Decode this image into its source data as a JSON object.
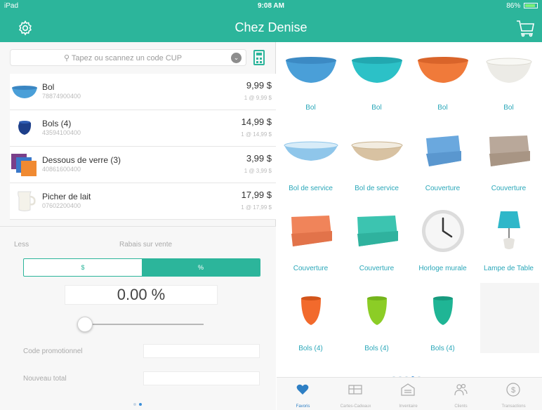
{
  "status": {
    "device": "iPad",
    "time": "9:08 AM",
    "battery": "86%",
    "battery_level": 0.86
  },
  "header": {
    "title": "Chez Denise"
  },
  "search": {
    "placeholder": "Tapez ou scannez un code CUP"
  },
  "cart": {
    "items": [
      {
        "name": "Bol",
        "sku": "78874900400",
        "price": "9,99 $",
        "unit": "1 @ 9,99 $",
        "thumb": "bowl-blue"
      },
      {
        "name": "Bols (4)",
        "sku": "43594100400",
        "price": "14,99 $",
        "unit": "1 @ 14,99 $",
        "thumb": "bowls-navy"
      },
      {
        "name": "Dessous de verre (3)",
        "sku": "40861600400",
        "price": "3,99 $",
        "unit": "1 @ 3,99 $",
        "thumb": "coasters"
      },
      {
        "name": "Picher de lait",
        "sku": "07602200400",
        "price": "17,99 $",
        "unit": "1 @ 17,99 $",
        "thumb": "milk-pitcher"
      }
    ]
  },
  "discount": {
    "less_label": "Less",
    "title": "Rabais sur vente",
    "toggle_dollar": "$",
    "toggle_percent": "%",
    "selected": "%",
    "amount": "0.00 %",
    "slider_value": 0,
    "promo_label": "Code promotionnel",
    "promo_value": "",
    "total_label": "Nouveau total",
    "total_value": "",
    "page_dots": 2,
    "active_page": 2
  },
  "grid": {
    "tiles": [
      {
        "label": "Bol",
        "icon": "bowl-blue",
        "color": "#4a9fd8"
      },
      {
        "label": "Bol",
        "icon": "bowl-teal",
        "color": "#2cc1c7"
      },
      {
        "label": "Bol",
        "icon": "bowl-orange",
        "color": "#f07a3a"
      },
      {
        "label": "Bol",
        "icon": "bowl-white",
        "color": "#ecebe6"
      },
      {
        "label": "Bol de service",
        "icon": "serving-bowl-blue",
        "color": "#8fc6ea"
      },
      {
        "label": "Bol de service",
        "icon": "serving-bowl-wood",
        "color": "#d8c2a2"
      },
      {
        "label": "Couverture",
        "icon": "blanket-blue",
        "color": "#6aa8de"
      },
      {
        "label": "Couverture",
        "icon": "blanket-beige",
        "color": "#b9a89a"
      },
      {
        "label": "Couverture",
        "icon": "blanket-orange",
        "color": "#f0845a"
      },
      {
        "label": "Couverture",
        "icon": "blanket-teal",
        "color": "#3cc4b0"
      },
      {
        "label": "Horloge murale",
        "icon": "wall-clock",
        "color": "#dcdcdc"
      },
      {
        "label": "Lampe de Table",
        "icon": "table-lamp",
        "color": "#2fb7c9"
      },
      {
        "label": "Bols (4)",
        "icon": "bowls-orange",
        "color": "#f26a2c"
      },
      {
        "label": "Bols (4)",
        "icon": "bowls-green",
        "color": "#8ccd26"
      },
      {
        "label": "Bols (4)",
        "icon": "bowls-teal",
        "color": "#1fb595"
      },
      {
        "label": "",
        "icon": "empty",
        "color": "#f5f5f5"
      }
    ],
    "page_dots": 5,
    "active_page": 4
  },
  "tabs": [
    {
      "label": "Favoris",
      "icon": "heart-icon",
      "active": true
    },
    {
      "label": "Cartes-Cadeaux",
      "icon": "gift-card-icon",
      "active": false
    },
    {
      "label": "Inventaire",
      "icon": "inventory-icon",
      "active": false
    },
    {
      "label": "Clients",
      "icon": "clients-icon",
      "active": false
    },
    {
      "label": "Transactions",
      "icon": "transactions-icon",
      "active": false
    }
  ],
  "colors": {
    "accent": "#2cb59b",
    "link": "#2aa7b9",
    "tab_active": "#2e7fc4"
  }
}
